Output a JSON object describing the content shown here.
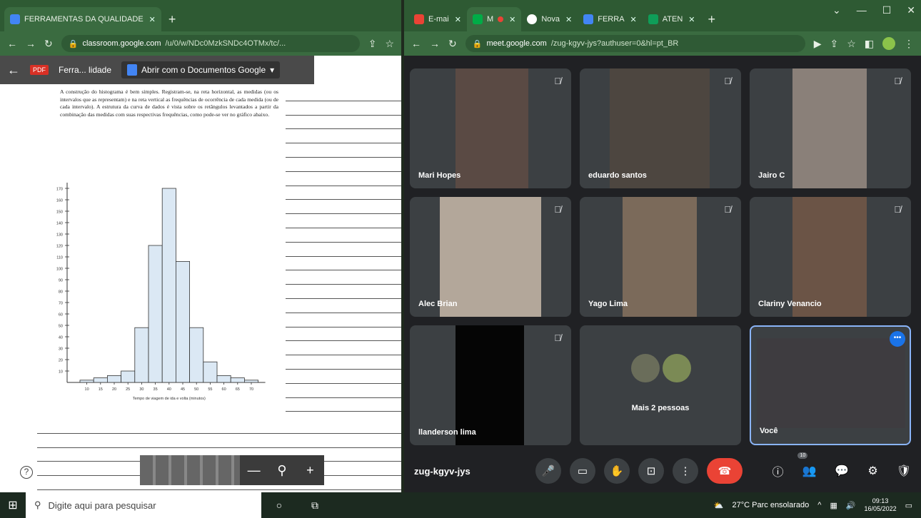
{
  "left_window": {
    "tab_title": "FERRAMENTAS DA QUALIDADE",
    "url_host": "classroom.google.com",
    "url_path": "/u/0/w/NDc0MzkSNDc4OTMx/tc/...",
    "pdf_badge": "PDF",
    "file_name": "Ferra... lidade",
    "open_with_docs": "Abrir com o Documentos Google",
    "paragraph": "A construção do histograma é bem simples. Registram-se, na reta horizontal, as medidas (ou os intervalos que as representam) e na reta vertical as frequências de ocorrência de cada medida (ou de cada intervalo). A estrutura da curva de dados é vista sobre os retângulos levantados a partir da combinação das medidas com suas respectivas frequências, como pode-se ver no gráfico abaixo.",
    "zoom_minus": "—",
    "zoom_icon": "magnifier-icon",
    "zoom_plus": "+",
    "help": "?"
  },
  "chart_data": {
    "type": "bar",
    "categories": [
      "10",
      "15",
      "20",
      "25",
      "30",
      "35",
      "40",
      "45",
      "50",
      "55",
      "60",
      "65",
      "70"
    ],
    "values": [
      2,
      4,
      6,
      10,
      48,
      120,
      170,
      106,
      48,
      18,
      6,
      4,
      2
    ],
    "xlabel": "Tempo de viagem de ida e volta (minutos)",
    "ylabel": "",
    "ylim": [
      0,
      170
    ],
    "yticks": [
      10,
      20,
      30,
      40,
      50,
      60,
      70,
      80,
      90,
      100,
      110,
      120,
      130,
      140,
      150,
      160,
      170
    ],
    "bar_color": "#dbe8f4"
  },
  "right_window": {
    "tabs": [
      {
        "label": "E-mai",
        "icon": "gmail-icon",
        "color": "#ea4335"
      },
      {
        "label": "M",
        "icon": "meet-icon",
        "color": "#00ac47"
      },
      {
        "label": "Nova",
        "icon": "chrome-icon",
        "color": "#ffffff"
      },
      {
        "label": "FERRA",
        "icon": "classroom-icon",
        "color": "#4285f4"
      },
      {
        "label": "ATEN",
        "icon": "classroom-icon",
        "color": "#0f9d58"
      }
    ],
    "url_host": "meet.google.com",
    "url_path": "/zug-kgyv-jys?authuser=0&hl=pt_BR",
    "participants": [
      {
        "name": "Mari Hopes",
        "bg": "#5a4a44"
      },
      {
        "name": "eduardo santos",
        "bg": "#4d4640"
      },
      {
        "name": "Jairo C",
        "bg": "#8a8079"
      },
      {
        "name": "Alec Brian",
        "bg": "#b3a79a"
      },
      {
        "name": "Yago Lima",
        "bg": "#7b6a5a"
      },
      {
        "name": "Clariny Venancio",
        "bg": "#6b5446"
      },
      {
        "name": "llanderson lima",
        "bg": "#050505"
      },
      {
        "name": "Mais 2 pessoas",
        "bg": "#3c4043"
      },
      {
        "name": "Você",
        "bg": "#3e3c40"
      }
    ],
    "meeting_code": "zug-kgyv-jys",
    "people_count": "10"
  },
  "taskbar": {
    "search_placeholder": "Digite aqui para pesquisar",
    "weather": "27°C Parc ensolarado",
    "time": "09:13",
    "date": "16/05/2022"
  }
}
